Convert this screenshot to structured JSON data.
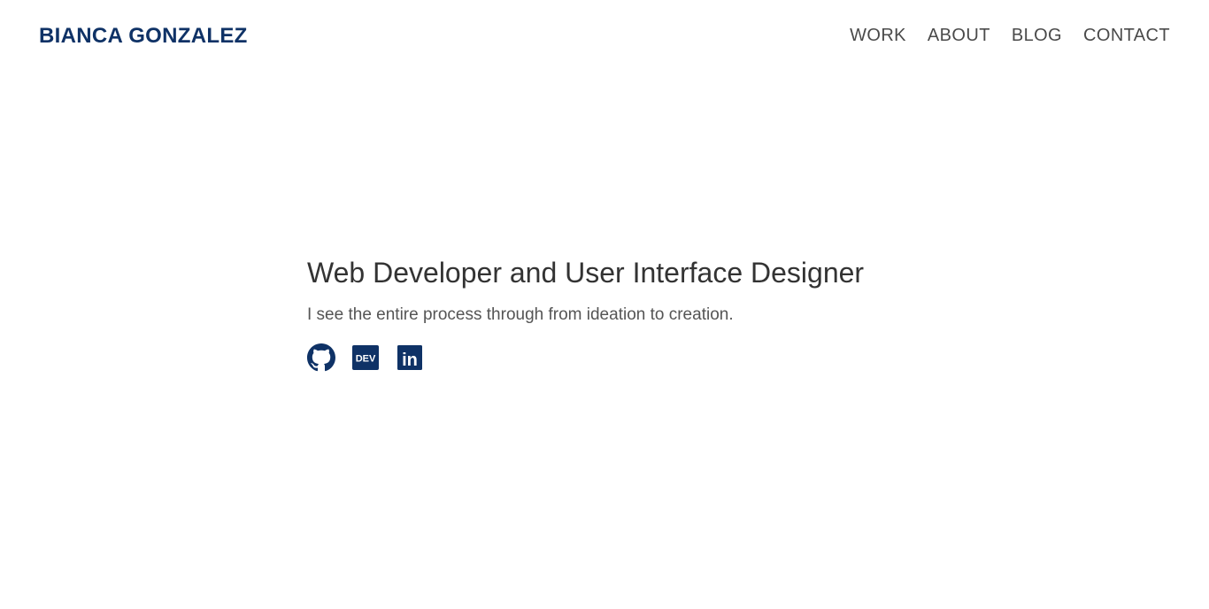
{
  "header": {
    "brand": "BIANCA GONZALEZ",
    "nav": [
      {
        "label": "WORK"
      },
      {
        "label": "ABOUT"
      },
      {
        "label": "BLOG"
      },
      {
        "label": "CONTACT"
      }
    ]
  },
  "hero": {
    "title": "Web Developer and User Interface Designer",
    "subtitle": "I see the entire process through from ideation to creation."
  },
  "social": [
    {
      "icon": "github-icon"
    },
    {
      "icon": "dev-icon",
      "text": "DEV"
    },
    {
      "icon": "linkedin-icon",
      "text": "in"
    }
  ],
  "colors": {
    "brand": "#0f3266",
    "nav_text": "#4a4a4a",
    "title_text": "#333333",
    "subtitle_text": "#555555",
    "background": "#ffffff"
  }
}
